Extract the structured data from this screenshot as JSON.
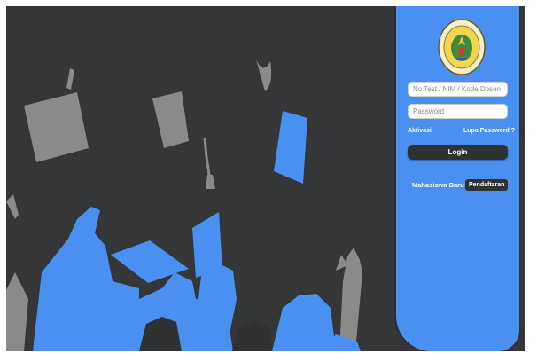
{
  "login_panel": {
    "username_placeholder": "No Test / NIM / Kode Dosen",
    "password_placeholder": "Password",
    "aktivasi_label": "Aktivasi",
    "lupa_password_label": "Lupa Password ?",
    "login_label": "Login",
    "mahasiswa_baru_label": "Mahasiswa Baru ?",
    "pendaftaran_label": "Pendaftaran"
  },
  "colors": {
    "background": "#353638",
    "accent_blue": "#4a90f0",
    "silhouette_gray": "#8a8a8a",
    "button_dark": "#2f3133"
  },
  "icons": {
    "logo": "university-seal",
    "illustration": "graduates-throwing-caps"
  }
}
